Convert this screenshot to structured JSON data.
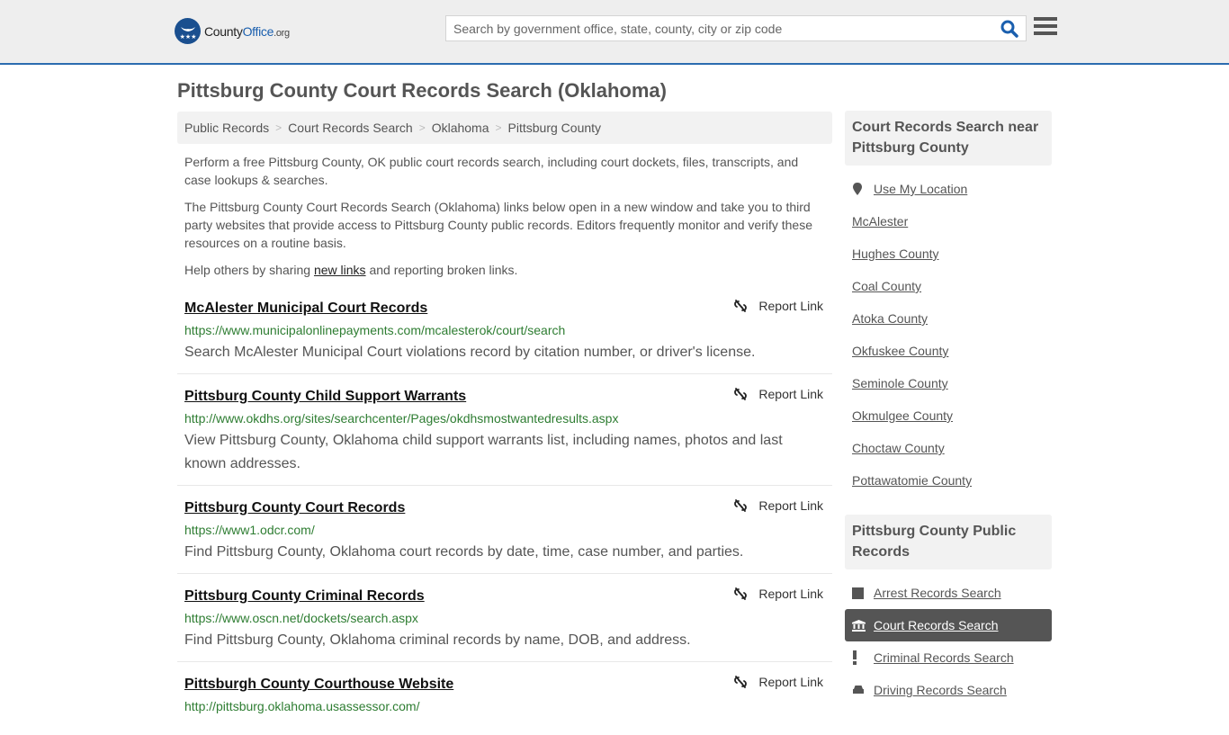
{
  "header": {
    "logo": {
      "name_part1": "County",
      "name_part2": "Office",
      "tld": ".org"
    },
    "search": {
      "placeholder": "Search by government office, state, county, city or zip code",
      "value": ""
    },
    "colors": {
      "brand_blue": "#1a4f8f",
      "header_bg": "#eeeeee",
      "accent_border": "#2b6cb0"
    }
  },
  "page": {
    "title": "Pittsburg County Court Records Search (Oklahoma)"
  },
  "breadcrumb": [
    {
      "label": "Public Records"
    },
    {
      "label": "Court Records Search"
    },
    {
      "label": "Oklahoma"
    },
    {
      "label": "Pittsburg County"
    }
  ],
  "breadcrumb_separator": ">",
  "intro": {
    "p1": "Perform a free Pittsburg County, OK public court records search, including court dockets, files, transcripts, and case lookups & searches.",
    "p2": "The Pittsburg County Court Records Search (Oklahoma) links below open in a new window and take you to third party websites that provide access to Pittsburg County public records. Editors frequently monitor and verify these resources on a routine basis.",
    "p3_before": "Help others by sharing ",
    "p3_link": "new links",
    "p3_after": " and reporting broken links."
  },
  "results": [
    {
      "title": "McAlester Municipal Court Records",
      "url": "https://www.municipalonlinepayments.com/mcalesterok/court/search",
      "description": "Search McAlester Municipal Court violations record by citation number, or driver's license.",
      "report_label": "Report Link"
    },
    {
      "title": "Pittsburg County Child Support Warrants",
      "url": "http://www.okdhs.org/sites/searchcenter/Pages/okdhsmostwantedresults.aspx",
      "description": "View Pittsburg County, Oklahoma child support warrants list, including names, photos and last known addresses.",
      "report_label": "Report Link"
    },
    {
      "title": "Pittsburg County Court Records",
      "url": "https://www1.odcr.com/",
      "description": "Find Pittsburg County, Oklahoma court records by date, time, case number, and parties.",
      "report_label": "Report Link"
    },
    {
      "title": "Pittsburg County Criminal Records",
      "url": "https://www.oscn.net/dockets/search.aspx",
      "description": "Find Pittsburg County, Oklahoma criminal records by name, DOB, and address.",
      "report_label": "Report Link"
    },
    {
      "title": "Pittsburgh County Courthouse Website",
      "url": "http://pittsburg.oklahoma.usassessor.com/",
      "description": "",
      "report_label": "Report Link"
    }
  ],
  "sidebar": {
    "nearby": {
      "heading": "Court Records Search near Pittsburg County",
      "use_location": {
        "label": "Use My Location",
        "icon": "map-marker-icon"
      },
      "items": [
        {
          "label": "McAlester"
        },
        {
          "label": "Hughes County"
        },
        {
          "label": "Coal County"
        },
        {
          "label": "Atoka County"
        },
        {
          "label": "Okfuskee County"
        },
        {
          "label": "Seminole County"
        },
        {
          "label": "Okmulgee County"
        },
        {
          "label": "Choctaw County"
        },
        {
          "label": "Pottawatomie County"
        }
      ]
    },
    "public_records": {
      "heading": "Pittsburg County Public Records",
      "items": [
        {
          "label": "Arrest Records Search",
          "icon": "square-icon",
          "active": false
        },
        {
          "label": "Court Records Search",
          "icon": "courthouse-icon",
          "active": true
        },
        {
          "label": "Criminal Records Search",
          "icon": "exclamation-icon",
          "active": false
        },
        {
          "label": "Driving Records Search",
          "icon": "car-icon",
          "active": false
        }
      ]
    }
  }
}
